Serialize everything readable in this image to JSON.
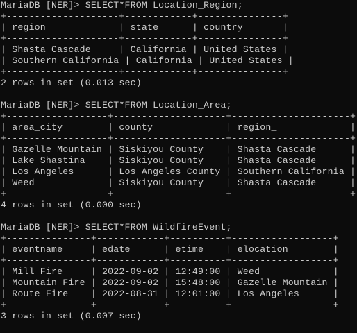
{
  "terminal": {
    "lines": [
      "MariaDB [NER]> SELECT*FROM Location_Region;",
      "+--------------------+------------+---------------+",
      "| region             | state      | country       |",
      "+--------------------+------------+---------------+",
      "| Shasta Cascade     | California | United States |",
      "| Southern California | California | United States |",
      "+--------------------+------------+---------------+",
      "2 rows in set (0.013 sec)",
      "",
      "MariaDB [NER]> SELECT*FROM Location_Area;",
      "+------------------+--------------------+---------------------+",
      "| area_city        | county             | region_             |",
      "+------------------+--------------------+---------------------+",
      "| Gazelle Mountain | Siskiyou County    | Shasta Cascade      |",
      "| Lake Shastina    | Siskiyou County    | Shasta Cascade      |",
      "| Los Angeles      | Los Angeles County | Southern California |",
      "| Weed             | Siskiyou County    | Shasta Cascade      |",
      "+------------------+--------------------+---------------------+",
      "4 rows in set (0.000 sec)",
      "",
      "MariaDB [NER]> SELECT*FROM WildfireEvent;",
      "+---------------+------------+----------+------------------+",
      "| eventname     | edate      | etime    | elocation        |",
      "+---------------+------------+----------+------------------+",
      "| Mill Fire     | 2022-09-02 | 12:49:00 | Weed             |",
      "| Mountain Fire | 2022-09-02 | 15:48:00 | Gazelle Mountain |",
      "| Route Fire    | 2022-08-31 | 12:01:00 | Los Angeles      |",
      "+---------------+------------+----------+------------------+",
      "3 rows in set (0.007 sec)"
    ]
  }
}
